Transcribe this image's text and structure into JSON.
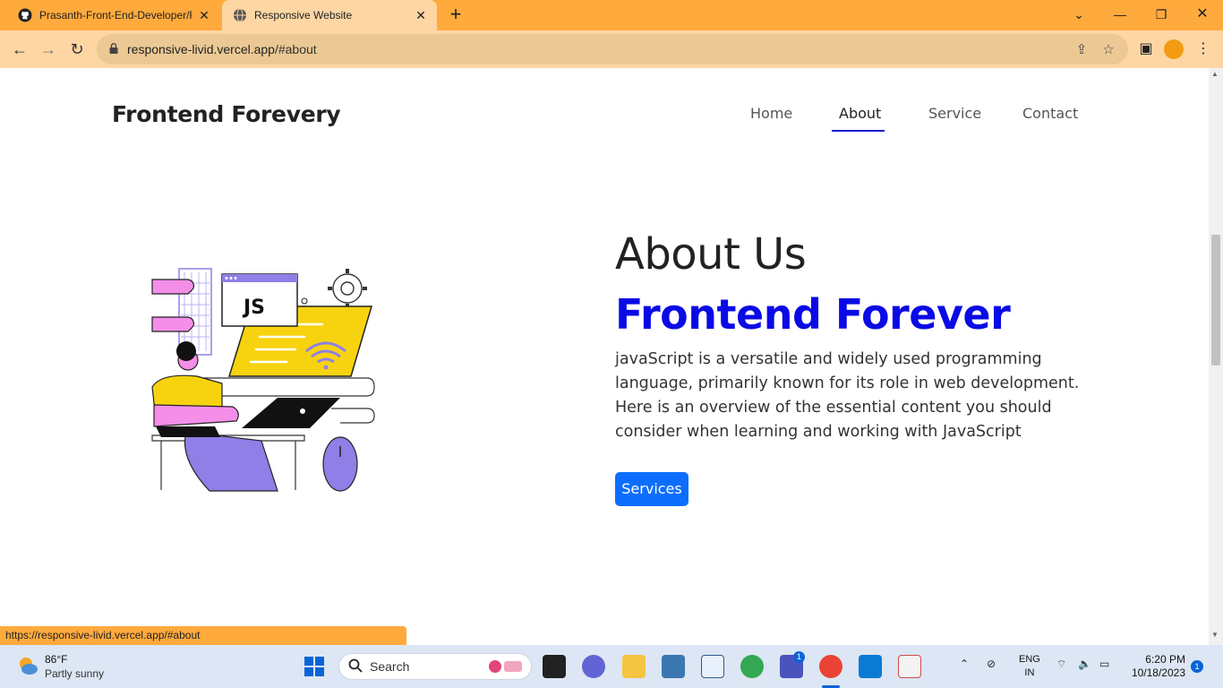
{
  "browser": {
    "tabs": [
      {
        "title": "Prasanth-Front-End-Developer/F",
        "icon": "github-icon"
      },
      {
        "title": "Responsive Website",
        "icon": "globe-icon"
      }
    ],
    "url_host": "responsive-livid.vercel.app",
    "url_path": "/#about",
    "status_url": "https://responsive-livid.vercel.app/#about"
  },
  "site": {
    "brand": "Frontend Forevery",
    "nav": [
      "Home",
      "About",
      "Service",
      "Contact"
    ],
    "active_nav": "About"
  },
  "about": {
    "heading": "About Us",
    "subheading": "Frontend Forever",
    "paragraph": "javaScript is a versatile and widely used programming language, primarily known for its role in web development. Here is an overview of the essential content you should consider when learning and working with JavaScript",
    "button_label": "Services",
    "illustration_text": "JS"
  },
  "taskbar": {
    "weather_temp": "86°F",
    "weather_desc": "Partly sunny",
    "search_label": "Search",
    "lang_line1": "ENG",
    "lang_line2": "IN",
    "time": "6:20 PM",
    "date": "10/18/2023",
    "notification_count": "1",
    "teams_badge": "1"
  },
  "colors": {
    "chrome": "#ffaa3d",
    "accent_blue": "#0a0ae6",
    "button_blue": "#0d6efd"
  }
}
